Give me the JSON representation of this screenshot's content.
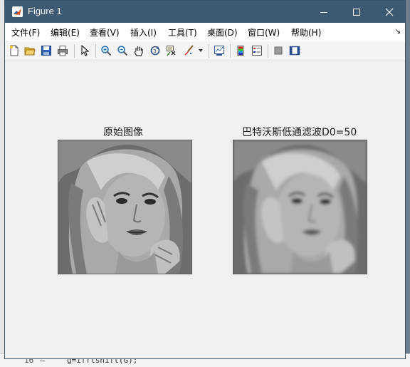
{
  "window": {
    "title": "Figure 1",
    "controls": [
      "minimize",
      "maximize",
      "close"
    ]
  },
  "menubar": {
    "items": [
      {
        "label": "文件(F)"
      },
      {
        "label": "编辑(E)"
      },
      {
        "label": "查看(V)"
      },
      {
        "label": "插入(I)"
      },
      {
        "label": "工具(T)"
      },
      {
        "label": "桌面(D)"
      },
      {
        "label": "窗口(W)"
      },
      {
        "label": "帮助(H)"
      }
    ],
    "dock_glyph": "↘"
  },
  "toolbar": {
    "buttons": [
      {
        "icon": "new-file-icon"
      },
      {
        "icon": "open-folder-icon"
      },
      {
        "icon": "save-icon"
      },
      {
        "icon": "print-icon"
      },
      {
        "icon": "pointer-icon"
      },
      {
        "icon": "zoom-in-icon"
      },
      {
        "icon": "zoom-out-icon"
      },
      {
        "icon": "pan-hand-icon"
      },
      {
        "icon": "rotate-3d-icon"
      },
      {
        "icon": "data-cursor-icon"
      },
      {
        "icon": "brush-icon"
      },
      {
        "icon": "link-plot-icon"
      },
      {
        "icon": "colorbar-icon"
      },
      {
        "icon": "legend-icon"
      },
      {
        "icon": "hide-plot-tools-icon"
      },
      {
        "icon": "show-plot-tools-icon"
      }
    ]
  },
  "figure": {
    "axes": [
      {
        "title": "原始图像",
        "image": "grayscale portrait (original)"
      },
      {
        "title": "巴特沃斯低通滤波D0=50",
        "image": "grayscale portrait (low-pass filtered)"
      }
    ]
  },
  "background_editor": {
    "line_number": "16",
    "line_marker": "—",
    "code": "g=ifftshift(G);"
  },
  "colors": {
    "titlebar": "#3c5a74",
    "menubar": "#ffffff",
    "canvas": "#f0f0f0"
  }
}
